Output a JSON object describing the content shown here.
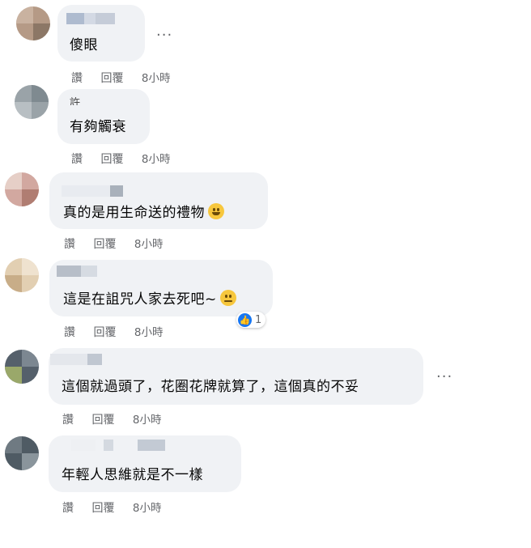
{
  "comments": [
    {
      "text": "傻眼",
      "actions": {
        "like": "讚",
        "reply": "回覆",
        "time": "8小時"
      },
      "more": "···"
    },
    {
      "text": "有夠觸衰",
      "name_fragment": "許慕元",
      "actions": {
        "like": "讚",
        "reply": "回覆",
        "time": "8小時"
      }
    },
    {
      "text": "真的是用生命送的禮物",
      "emoji": "grinning-sweat-emoji",
      "actions": {
        "like": "讚",
        "reply": "回覆",
        "time": "8小時"
      }
    },
    {
      "text": "這是在詛咒人家去死吧~",
      "emoji": "neutral-face-emoji",
      "reaction": {
        "icon": "like-icon",
        "count": "1"
      },
      "actions": {
        "like": "讚",
        "reply": "回覆",
        "time": "8小時"
      }
    },
    {
      "text": "這個就過頭了，花圈花牌就算了，這個真的不妥",
      "actions": {
        "like": "讚",
        "reply": "回覆",
        "time": "8小時"
      },
      "more": "···"
    },
    {
      "text": "年輕人思維就是不一樣",
      "actions": {
        "like": "讚",
        "reply": "回覆",
        "time": "8小時"
      }
    }
  ],
  "colors": {
    "bubble": "#f0f2f5",
    "action_text": "#65676b",
    "like_blue": "#1877f2"
  }
}
